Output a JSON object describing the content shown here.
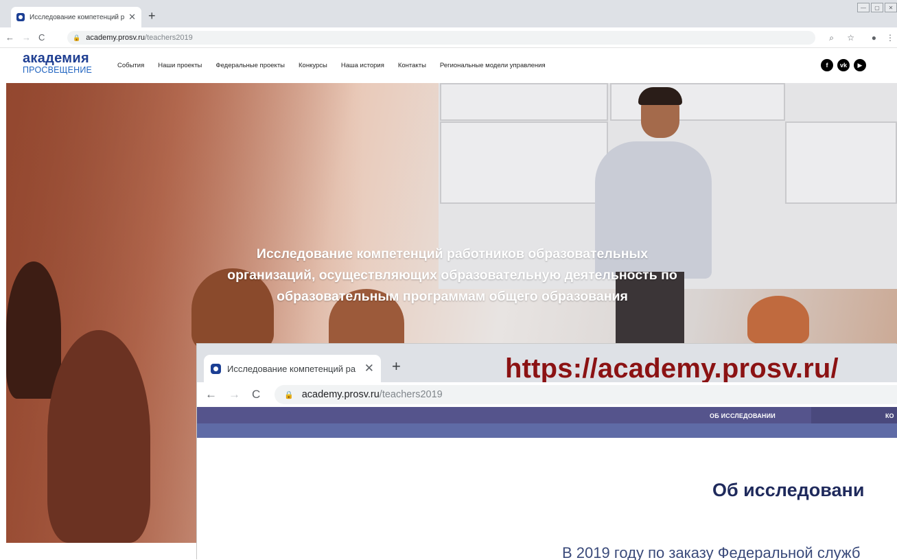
{
  "browser": {
    "tab_title": "Исследование компетенций ра",
    "tab_close": "✕",
    "new_tab": "+",
    "url_host": "academy.prosv.ru",
    "url_path": "/teachers2019",
    "window_controls": [
      "—",
      "▢",
      "✕"
    ]
  },
  "site": {
    "logo_line1": "академия",
    "logo_line2": "ПРОСВЕЩЕНИЕ",
    "menu": [
      "События",
      "Наши проекты",
      "Федеральные проекты",
      "Конкурсы",
      "Наша история",
      "Контакты",
      "Региональные модели управления"
    ],
    "social_icons": [
      "facebook-icon",
      "vk-icon",
      "youtube-icon"
    ],
    "hero_title": "Исследование компетенций работников образовательных организаций, осуществляющих образовательную деятельность по образовательным программам общего образования"
  },
  "overlay": {
    "tab_title": "Исследование компетенций ра",
    "tab_close": "✕",
    "new_tab": "+",
    "big_url": "https://academy.prosv.ru/",
    "url_host": "academy.prosv.ru",
    "url_path": "/teachers2019",
    "nav_item_1": "ОБ ИССЛЕДОВАНИИ",
    "nav_item_2": "КО",
    "heading": "Об исследовани",
    "paragraph": "В 2019 году по заказу Федеральной служб"
  },
  "colors": {
    "brand_dark_blue": "#1f3f92",
    "brand_blue": "#1f63c0",
    "overlay_nav": "#55548c",
    "big_url_red": "#8b1213"
  }
}
